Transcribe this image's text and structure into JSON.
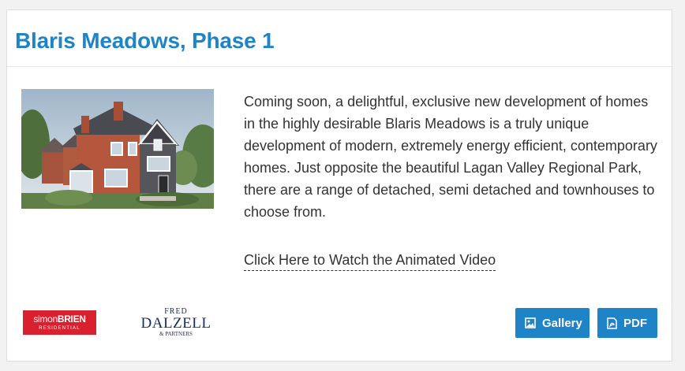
{
  "card": {
    "title": "Blaris Meadows, Phase 1",
    "image_alt": "Rendering of a red brick detached house with a dark grey stone gable",
    "description": "Coming soon, a delightful, exclusive new development of homes in the highly desirable Blaris Meadows is a truly unique development of modern, extremely energy efficient, contemporary homes. Just opposite the beautiful Lagan Valley Regional Park, there are a range of detached, semi detached and townhouses to choose from.",
    "video_link": "Click Here to Watch the Animated Video"
  },
  "logos": {
    "simon_brien": {
      "part1": "simon",
      "part2": "BRIEN",
      "sub": "RESIDENTIAL"
    },
    "fred_dalzell": {
      "line1": "FRED",
      "line2": "DALZELL",
      "line3": "& PARTNERS"
    }
  },
  "buttons": {
    "gallery": {
      "label": "Gallery",
      "icon": "image-icon"
    },
    "pdf": {
      "label": "PDF",
      "icon": "pdf-file-icon"
    }
  },
  "colors": {
    "accent": "#1f83c7",
    "logo_red": "#d8202f",
    "logo_navy": "#1a2b5a",
    "text": "#333333"
  }
}
